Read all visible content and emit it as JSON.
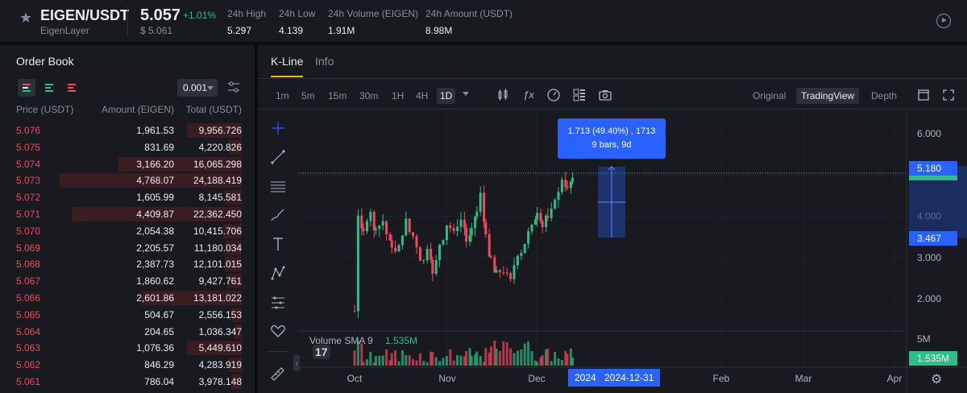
{
  "header": {
    "pair": "EIGEN/USDT",
    "pair_sub": "EigenLayer",
    "price": "5.057",
    "change": "+1.01%",
    "price_usd": "$ 5.061",
    "stats": [
      {
        "label": "24h High",
        "value": "5.297"
      },
      {
        "label": "24h Low",
        "value": "4.139"
      },
      {
        "label": "24h Volume (EIGEN)",
        "value": "1.91M"
      },
      {
        "label": "24h Amount (USDT)",
        "value": "8.98M"
      }
    ]
  },
  "orderbook": {
    "title": "Order Book",
    "precision": "0.001",
    "headers": {
      "price": "Price (USDT)",
      "amount": "Amount (EIGEN)",
      "total": "Total (USDT)"
    },
    "asks": [
      {
        "price": "5.076",
        "amount": "1,961.53",
        "total": "9,956.726",
        "depth": 0.26
      },
      {
        "price": "5.075",
        "amount": "831.69",
        "total": "4,220.826",
        "depth": 0.06
      },
      {
        "price": "5.074",
        "amount": "3,166.20",
        "total": "16,065.298",
        "depth": 0.59
      },
      {
        "price": "5.073",
        "amount": "4,768.07",
        "total": "24,188.419",
        "depth": 0.87
      },
      {
        "price": "5.072",
        "amount": "1,605.99",
        "total": "8,145.581",
        "depth": 0.08
      },
      {
        "price": "5.071",
        "amount": "4,409.87",
        "total": "22,362.450",
        "depth": 0.81
      },
      {
        "price": "5.070",
        "amount": "2,054.38",
        "total": "10,415.706",
        "depth": 0.09
      },
      {
        "price": "5.069",
        "amount": "2,205.57",
        "total": "11,180.034",
        "depth": 0.08
      },
      {
        "price": "5.068",
        "amount": "2,387.73",
        "total": "12,101.015",
        "depth": 0.08
      },
      {
        "price": "5.067",
        "amount": "1,860.62",
        "total": "9,427.761",
        "depth": 0.07
      },
      {
        "price": "5.066",
        "amount": "2,601.86",
        "total": "13,181.022",
        "depth": 0.48
      },
      {
        "price": "5.065",
        "amount": "504.67",
        "total": "2,556.153",
        "depth": 0.05
      },
      {
        "price": "5.064",
        "amount": "204.65",
        "total": "1,036.347",
        "depth": 0.04
      },
      {
        "price": "5.063",
        "amount": "1,076.36",
        "total": "5,449.610",
        "depth": 0.26
      },
      {
        "price": "5.062",
        "amount": "846.29",
        "total": "4,283.919",
        "depth": 0.06
      },
      {
        "price": "5.061",
        "amount": "786.04",
        "total": "3,978.148",
        "depth": 0.05
      }
    ]
  },
  "chart": {
    "tabs": [
      "K-Line",
      "Info"
    ],
    "timeframes": [
      "1m",
      "5m",
      "15m",
      "30m",
      "1H",
      "4H",
      "1D"
    ],
    "active_timeframe": "1D",
    "views": [
      "Original",
      "TradingView",
      "Depth"
    ],
    "active_view": "TradingView",
    "price_ticks": [
      "6.000",
      "4.000",
      "3.000",
      "2.000"
    ],
    "price_tag_top": "5.180",
    "price_tag_mid": "3.467",
    "last_price_tag": "5.057",
    "time_ticks": [
      "Oct",
      "Nov",
      "Dec",
      "Feb",
      "Mar",
      "Apr"
    ],
    "year_tag": "2024",
    "date_tag": "2024-12-31",
    "tooltip_line1": "1.713 (49.40%) , 1713",
    "tooltip_line2": "9 bars, 9d",
    "volume_label": "Volume SMA 9",
    "volume_value": "1.535M",
    "volume_tick": "5M",
    "volume_tag": "1.535M",
    "tv_logo": "17",
    "colors": {
      "up": "#2ebd85",
      "down": "#f6465d",
      "accent": "#2962ff"
    }
  }
}
